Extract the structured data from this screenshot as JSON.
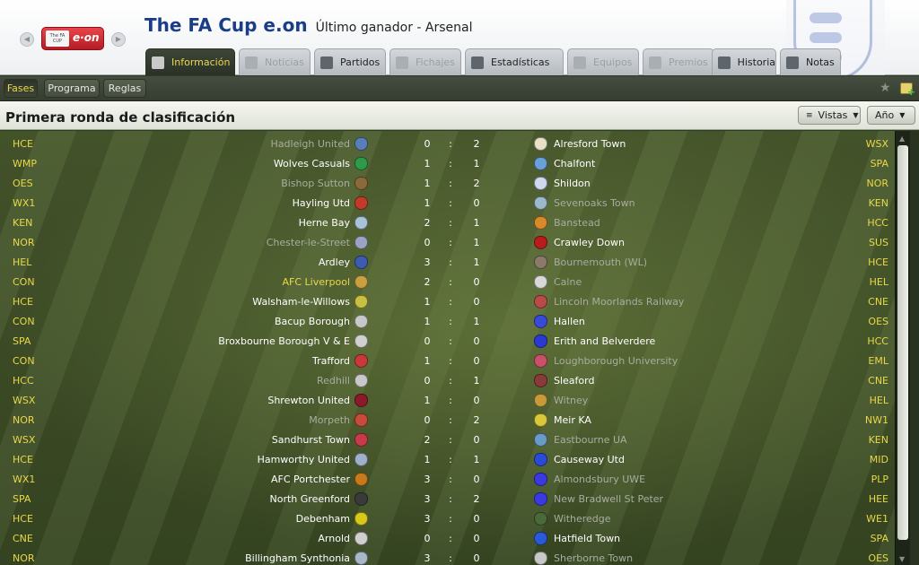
{
  "header": {
    "title": "The FA Cup e.on",
    "subtitle": "Último ganador - Arsenal",
    "logo_text_small": "The FA CUP",
    "logo_text_brand": "e·on"
  },
  "tabs": [
    {
      "label": "Información",
      "icon": "info-list-icon",
      "state": "active"
    },
    {
      "label": "Noticias",
      "icon": "news-icon",
      "state": "disabled"
    },
    {
      "label": "Partidos",
      "icon": "shield-icon",
      "state": "enabled"
    },
    {
      "label": "Fichajes",
      "icon": "transfer-arrows-icon",
      "state": "disabled"
    },
    {
      "label": "Estadísticas",
      "icon": "stats-bars-icon",
      "state": "enabled"
    },
    {
      "label": "Equipos",
      "icon": "shield-icon",
      "state": "disabled"
    },
    {
      "label": "Premios",
      "icon": "trophy-icon",
      "state": "disabled"
    },
    {
      "label": "Historia",
      "icon": "book-icon",
      "state": "enabled"
    },
    {
      "label": "Notas",
      "icon": "note-icon",
      "state": "enabled"
    }
  ],
  "subnav": [
    {
      "label": "Fases",
      "active": true
    },
    {
      "label": "Programa",
      "active": false
    },
    {
      "label": "Reglas",
      "active": false
    }
  ],
  "section": {
    "title": "Primera ronda de clasificación",
    "views_label": "Vistas",
    "year_label": "Año"
  },
  "colors": {
    "accent_yellow": "#e8d84a",
    "title_blue": "#1a3d86",
    "dim_text": "#a8ad9f"
  },
  "fixtures": [
    {
      "home_region": "HCE",
      "home": "Hadleigh United",
      "home_dim": true,
      "home_badge": "#5a7fb8",
      "hs": "0",
      "as": "2",
      "away": "Alresford Town",
      "away_dim": false,
      "away_badge": "#e8e0c8",
      "away_region": "WSX"
    },
    {
      "home_region": "WMP",
      "home": "Wolves Casuals",
      "home_dim": false,
      "home_badge": "#2f9a4a",
      "hs": "1",
      "as": "1",
      "away": "Chalfont",
      "away_dim": false,
      "away_badge": "#6aa0d8",
      "away_region": "SPA"
    },
    {
      "home_region": "OES",
      "home": "Bishop Sutton",
      "home_dim": true,
      "home_badge": "#8a6a3a",
      "hs": "1",
      "as": "2",
      "away": "Shildon",
      "away_dim": false,
      "away_badge": "#d0d8f0",
      "away_region": "NOR"
    },
    {
      "home_region": "WX1",
      "home": "Hayling Utd",
      "home_dim": false,
      "home_badge": "#c23b2a",
      "hs": "1",
      "as": "0",
      "away": "Sevenoaks Town",
      "away_dim": true,
      "away_badge": "#9ab9cc",
      "away_region": "KEN"
    },
    {
      "home_region": "KEN",
      "home": "Herne Bay",
      "home_dim": false,
      "home_badge": "#a8c2d8",
      "hs": "2",
      "as": "1",
      "away": "Banstead",
      "away_dim": true,
      "away_badge": "#d88a2a",
      "away_region": "HCC"
    },
    {
      "home_region": "NOR",
      "home": "Chester-le-Street",
      "home_dim": true,
      "home_badge": "#9aa4c0",
      "hs": "0",
      "as": "1",
      "away": "Crawley Down",
      "away_dim": false,
      "away_badge": "#b81c1c",
      "away_region": "SUS"
    },
    {
      "home_region": "HEL",
      "home": "Ardley",
      "home_dim": false,
      "home_badge": "#3c5cb0",
      "hs": "3",
      "as": "1",
      "away": "Bournemouth (WL)",
      "away_dim": true,
      "away_badge": "#8a7a6a",
      "away_region": "HCE"
    },
    {
      "home_region": "CON",
      "home": "AFC Liverpool",
      "home_dim": false,
      "home_yellow": true,
      "home_badge": "#c8a040",
      "hs": "2",
      "as": "0",
      "away": "Calne",
      "away_dim": true,
      "away_badge": "#d8d8d8",
      "away_region": "HEL"
    },
    {
      "home_region": "HCE",
      "home": "Walsham-le-Willows",
      "home_dim": false,
      "home_badge": "#c8c040",
      "hs": "1",
      "as": "0",
      "away": "Lincoln Moorlands Railway",
      "away_dim": true,
      "away_badge": "#b84a4a",
      "away_region": "CNE"
    },
    {
      "home_region": "CON",
      "home": "Bacup Borough",
      "home_dim": false,
      "home_badge": "#c8c8c8",
      "hs": "1",
      "as": "1",
      "away": "Hallen",
      "away_dim": false,
      "away_badge": "#3a4ad8",
      "away_region": "OES"
    },
    {
      "home_region": "SPA",
      "home": "Broxbourne Borough V & E",
      "home_dim": false,
      "home_badge": "#d0d0d0",
      "hs": "0",
      "as": "0",
      "away": "Erith and Belverdere",
      "away_dim": false,
      "away_badge": "#2a3ad0",
      "away_region": "HCC"
    },
    {
      "home_region": "CON",
      "home": "Trafford",
      "home_dim": false,
      "home_badge": "#c83a3a",
      "hs": "1",
      "as": "0",
      "away": "Loughborough University",
      "away_dim": true,
      "away_badge": "#c8506a",
      "away_region": "EML"
    },
    {
      "home_region": "HCC",
      "home": "Redhill",
      "home_dim": true,
      "home_badge": "#c8c8c8",
      "hs": "0",
      "as": "1",
      "away": "Sleaford",
      "away_dim": false,
      "away_badge": "#8a3a3a",
      "away_region": "CNE"
    },
    {
      "home_region": "WSX",
      "home": "Shrewton United",
      "home_dim": false,
      "home_badge": "#8a1a2a",
      "hs": "1",
      "as": "0",
      "away": "Witney",
      "away_dim": true,
      "away_badge": "#c89a3a",
      "away_region": "HEL"
    },
    {
      "home_region": "NOR",
      "home": "Morpeth",
      "home_dim": true,
      "home_badge": "#c84a3a",
      "hs": "0",
      "as": "2",
      "away": "Meir KA",
      "away_dim": false,
      "away_badge": "#d8c83a",
      "away_region": "NW1"
    },
    {
      "home_region": "WSX",
      "home": "Sandhurst Town",
      "home_dim": false,
      "home_badge": "#c83a4a",
      "hs": "2",
      "as": "0",
      "away": "Eastbourne UA",
      "away_dim": true,
      "away_badge": "#6a9ac8",
      "away_region": "KEN"
    },
    {
      "home_region": "HCE",
      "home": "Hamworthy United",
      "home_dim": false,
      "home_badge": "#a0b0c8",
      "hs": "1",
      "as": "1",
      "away": "Causeway Utd",
      "away_dim": false,
      "away_badge": "#2a4ad8",
      "away_region": "MID"
    },
    {
      "home_region": "WX1",
      "home": "AFC Portchester",
      "home_dim": false,
      "home_badge": "#c87a1a",
      "hs": "3",
      "as": "0",
      "away": "Almondsbury UWE",
      "away_dim": true,
      "away_badge": "#3a3ae0",
      "away_region": "PLP"
    },
    {
      "home_region": "SPA",
      "home": "North Greenford",
      "home_dim": false,
      "home_badge": "#3a3a3a",
      "hs": "3",
      "as": "2",
      "away": "New Bradwell St Peter",
      "away_dim": true,
      "away_badge": "#3a3ae0",
      "away_region": "HEE"
    },
    {
      "home_region": "HCE",
      "home": "Debenham",
      "home_dim": false,
      "home_badge": "#d8c81a",
      "hs": "3",
      "as": "0",
      "away": "Witheredge",
      "away_dim": true,
      "away_badge": "#4a6a3a",
      "away_region": "WE1"
    },
    {
      "home_region": "CNE",
      "home": "Arnold",
      "home_dim": false,
      "home_badge": "#d0d0d0",
      "hs": "0",
      "as": "0",
      "away": "Hatfield Town",
      "away_dim": false,
      "away_badge": "#2a5ad8",
      "away_region": "SPA"
    },
    {
      "home_region": "NOR",
      "home": "Billingham Synthonia",
      "home_dim": false,
      "home_badge": "#a8b8c8",
      "hs": "3",
      "as": "0",
      "away": "Sherborne Town",
      "away_dim": true,
      "away_badge": "#c8c8c8",
      "away_region": "OES"
    }
  ]
}
